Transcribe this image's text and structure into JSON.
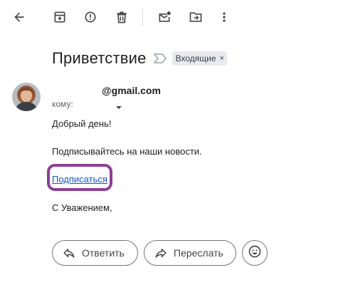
{
  "toolbar": {
    "icons": [
      "back-arrow-icon",
      "archive-icon",
      "report-spam-icon",
      "delete-icon",
      "mark-unread-icon",
      "move-to-icon",
      "more-vert-icon"
    ]
  },
  "message": {
    "subject": "Приветствие",
    "label": "Входящие",
    "label_remove": "×",
    "sender_email": "@gmail.com",
    "recipients_label": "кому:",
    "body": {
      "greeting": "Добрый день!",
      "text": "Подписывайтесь на наши новости.",
      "link_text": "Подписаться",
      "closing": "С Уважением,"
    }
  },
  "actions": {
    "reply_label": "Ответить",
    "forward_label": "Переслать"
  },
  "colors": {
    "link": "#1155cc",
    "highlight": "#8e3e96",
    "chip_bg": "#e8eaed"
  }
}
